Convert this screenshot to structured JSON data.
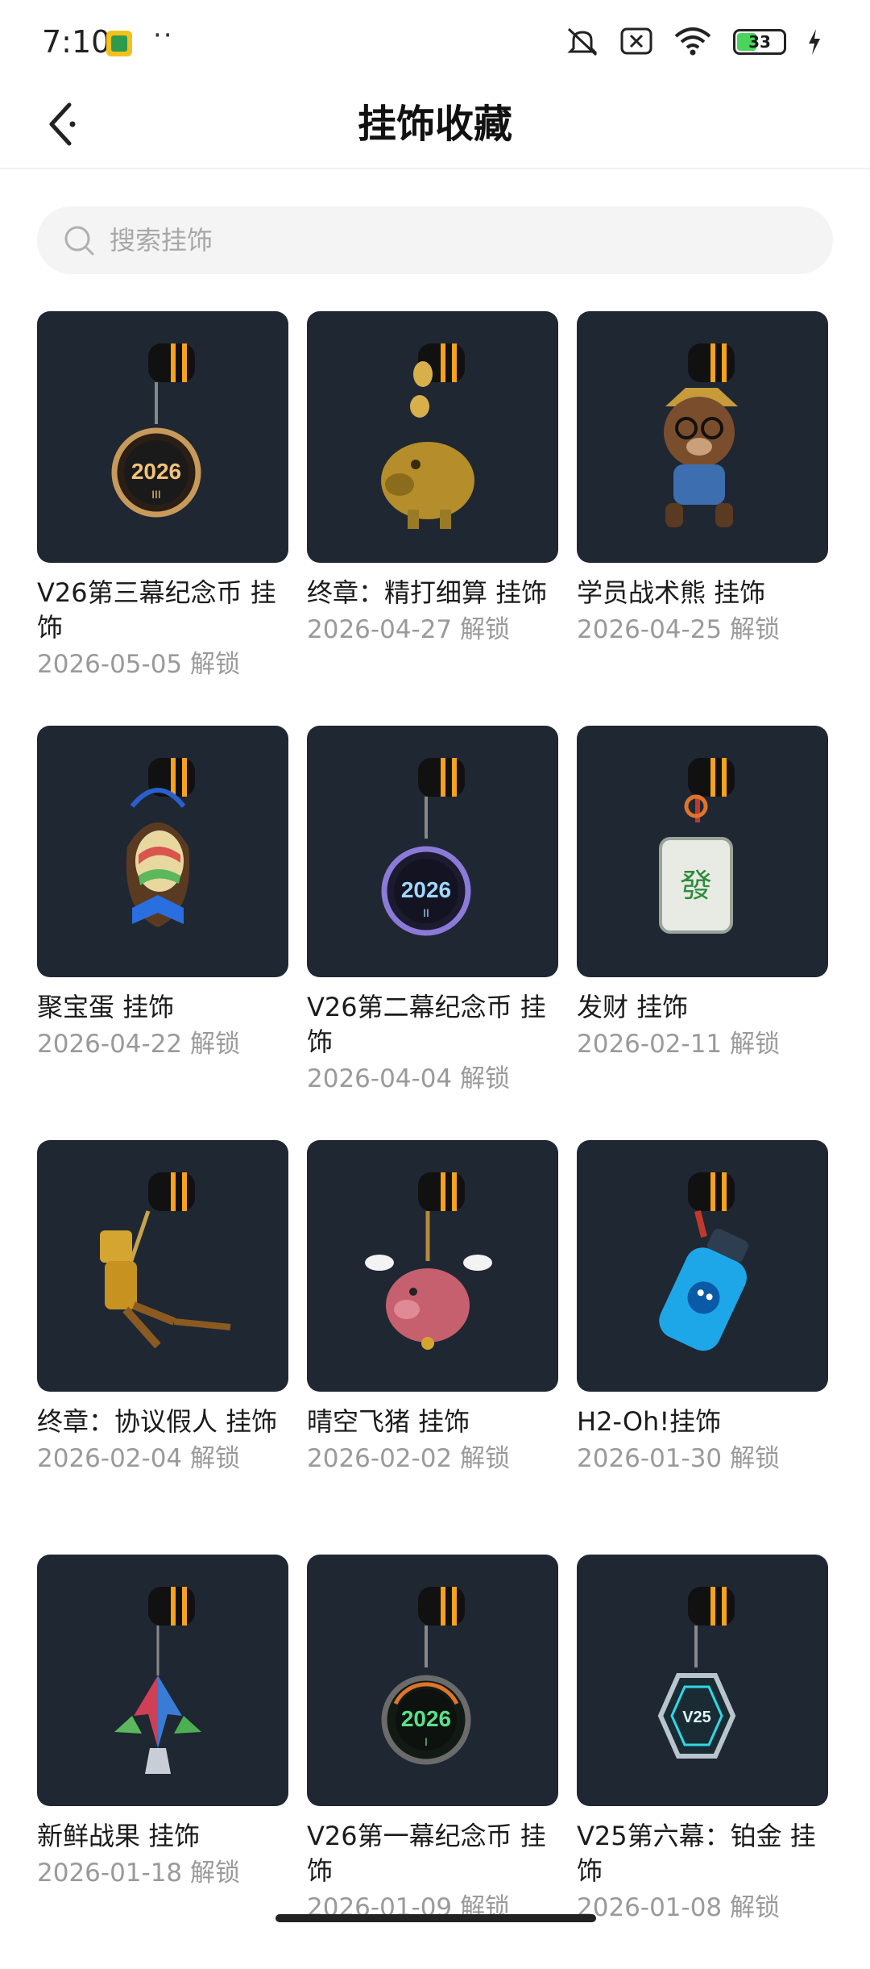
{
  "status_bar": {
    "time": "7:10",
    "extra": "··",
    "battery": "33"
  },
  "header": {
    "title": "挂饰收藏"
  },
  "search": {
    "placeholder": "搜索挂饰"
  },
  "items": [
    {
      "name": "V26第三幕纪念币 挂饰",
      "date": "2026-05-05 解锁",
      "icon": "coin-2026-iii"
    },
    {
      "name": "终章：精打细算 挂饰",
      "date": "2026-04-27 解锁",
      "icon": "gold-piggy"
    },
    {
      "name": "学员战术熊 挂饰",
      "date": "2026-04-25 解锁",
      "icon": "bear"
    },
    {
      "name": "聚宝蛋 挂饰",
      "date": "2026-04-22 解锁",
      "icon": "egg"
    },
    {
      "name": "V26第二幕纪念币 挂饰",
      "date": "2026-04-04 解锁",
      "icon": "coin-2026-ii"
    },
    {
      "name": "发财 挂饰",
      "date": "2026-02-11 解锁",
      "icon": "mahjong"
    },
    {
      "name": "终章：协议假人 挂饰",
      "date": "2026-02-04 解锁",
      "icon": "gold-robot"
    },
    {
      "name": "晴空飞猪 挂饰",
      "date": "2026-02-02 解锁",
      "icon": "flying-pig"
    },
    {
      "name": "H2-Oh!挂饰",
      "date": "2026-01-30 解锁",
      "icon": "water-bottle"
    },
    {
      "name": "新鲜战果 挂饰",
      "date": "2026-01-18 解锁",
      "icon": "leaf"
    },
    {
      "name": "V26第一幕纪念币 挂饰",
      "date": "2026-01-09 解锁",
      "icon": "coin-2026-i"
    },
    {
      "name": "V25第六幕：铂金 挂饰",
      "date": "2026-01-08 解锁",
      "icon": "v25-tag"
    }
  ],
  "colors": {
    "card_bg": "#1f2733",
    "accent_orange": "#f7a21b"
  }
}
